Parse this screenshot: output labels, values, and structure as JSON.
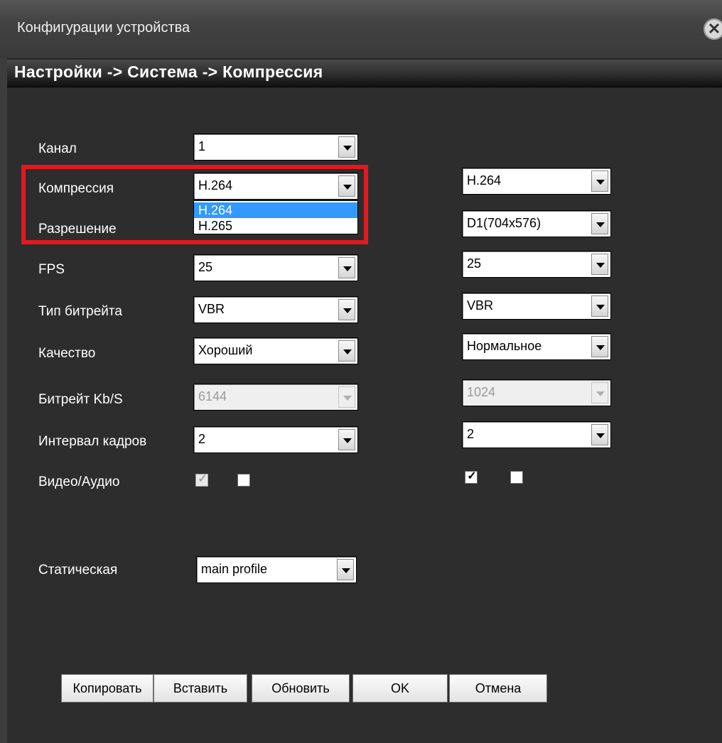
{
  "window": {
    "title": "Конфигурации устройства",
    "close_glyph": "✕"
  },
  "breadcrumb": "Настройки -> Система -> Компрессия",
  "form": {
    "rows": [
      {
        "label": "Канал",
        "main": "1",
        "extra": null
      },
      {
        "label": "Компрессия",
        "main": "H.264",
        "extra": "H.264"
      },
      {
        "label": "Разрешение",
        "main": "",
        "extra": "D1(704x576)"
      },
      {
        "label": "FPS",
        "main": "25",
        "extra": "25"
      },
      {
        "label": "Тип битрейта",
        "main": "VBR",
        "extra": "VBR"
      },
      {
        "label": "Качество",
        "main": "Хороший",
        "extra": "Нормальное"
      },
      {
        "label": "Битрейт Kb/S",
        "main": "6144",
        "extra": "1024"
      },
      {
        "label": "Интервал кадров",
        "main": "2",
        "extra": "2"
      },
      {
        "label": "Видео/Аудио",
        "main": "",
        "extra": ""
      }
    ],
    "compression_dropdown": {
      "open": true,
      "options": [
        "H.264",
        "H.265"
      ],
      "selected_index": 0
    },
    "static_label": "Статическая",
    "static_value": "main profile"
  },
  "checkboxes": {
    "main_video": true,
    "main_audio": false,
    "extra_video": true,
    "extra_audio": false
  },
  "buttons": {
    "copy": "Копировать",
    "paste": "Вставить",
    "refresh": "Обновить",
    "ok": "OK",
    "cancel": "Отмена"
  },
  "colors": {
    "background": "#2d2d2d",
    "highlight_box": "#e3191f",
    "selection": "#3399ff"
  }
}
